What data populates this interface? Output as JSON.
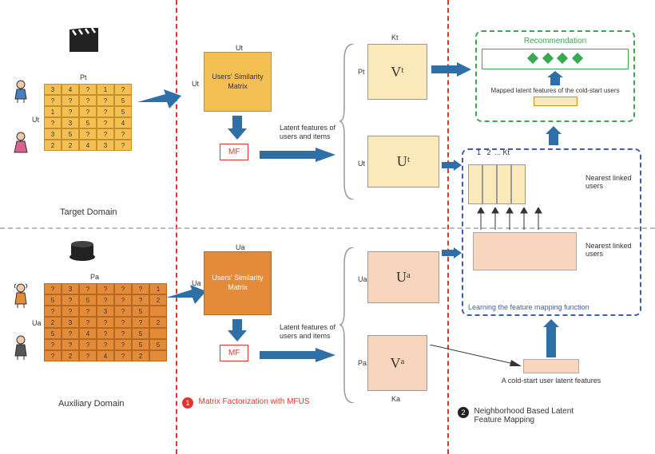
{
  "target": {
    "name": "Target Domain",
    "pAxis": "Pt",
    "uAxis": "Ut",
    "table": [
      [
        "3",
        "4",
        "?",
        "1",
        "?"
      ],
      [
        "?",
        "?",
        "?",
        "?",
        "5"
      ],
      [
        "1",
        "?",
        "?",
        "?",
        "5"
      ],
      [
        "?",
        "3",
        "5",
        "?",
        "4"
      ],
      [
        "3",
        "5",
        "?",
        "?",
        "?"
      ],
      [
        "2",
        "2",
        "4",
        "3",
        "?"
      ]
    ],
    "simLabel": "Users' Similarity Matrix",
    "simUa": "Ut",
    "simTop": "Ut",
    "mf": "MF",
    "latentLabel": "Latent features of users and items",
    "vLabel": "Vᵗ",
    "uLabel": "Uᵗ",
    "vSide": "Pt",
    "vTop": "Kt",
    "uSide": "Ut"
  },
  "aux": {
    "name": "Auxiliary Domain",
    "pAxis": "Pa",
    "uAxis": "Ua",
    "table": [
      [
        "?",
        "3",
        "?",
        "?",
        "?",
        "?",
        "1"
      ],
      [
        "5",
        "?",
        "5",
        "?",
        "?",
        "?",
        "2"
      ],
      [
        "?",
        "?",
        "?",
        "3",
        "?",
        "5",
        ""
      ],
      [
        "2",
        "3",
        "?",
        "?",
        "?",
        "?",
        "2"
      ],
      [
        "5",
        "?",
        "4",
        "?",
        "?",
        "5",
        ""
      ],
      [
        "?",
        "?",
        "?",
        "?",
        "?",
        "5",
        "5"
      ],
      [
        "?",
        "2",
        "?",
        "4",
        "?",
        "2",
        ""
      ]
    ],
    "simLabel": "Users' Similarity Matrix",
    "simUa": "Ua",
    "simTop": "Ua",
    "mf": "MF",
    "latentLabel": "Latent features of users and items",
    "vLabel": "Vᵃ",
    "uLabel": "Uᵃ",
    "vSide": "Pa",
    "vBot": "Ka",
    "uSide": "Ua"
  },
  "step1": "Matrix Factorization with MFUS",
  "step2": "Neighborhood Based Latent Feature Mapping",
  "rec": {
    "title": "Recommendation",
    "mapped": "Mapped latent features of the cold-start users"
  },
  "nearest": "Nearest linked users",
  "learning": "Learning the feature mapping function",
  "cold": "A cold-start user latent features",
  "ktLabels": "1   2  ... Kt"
}
